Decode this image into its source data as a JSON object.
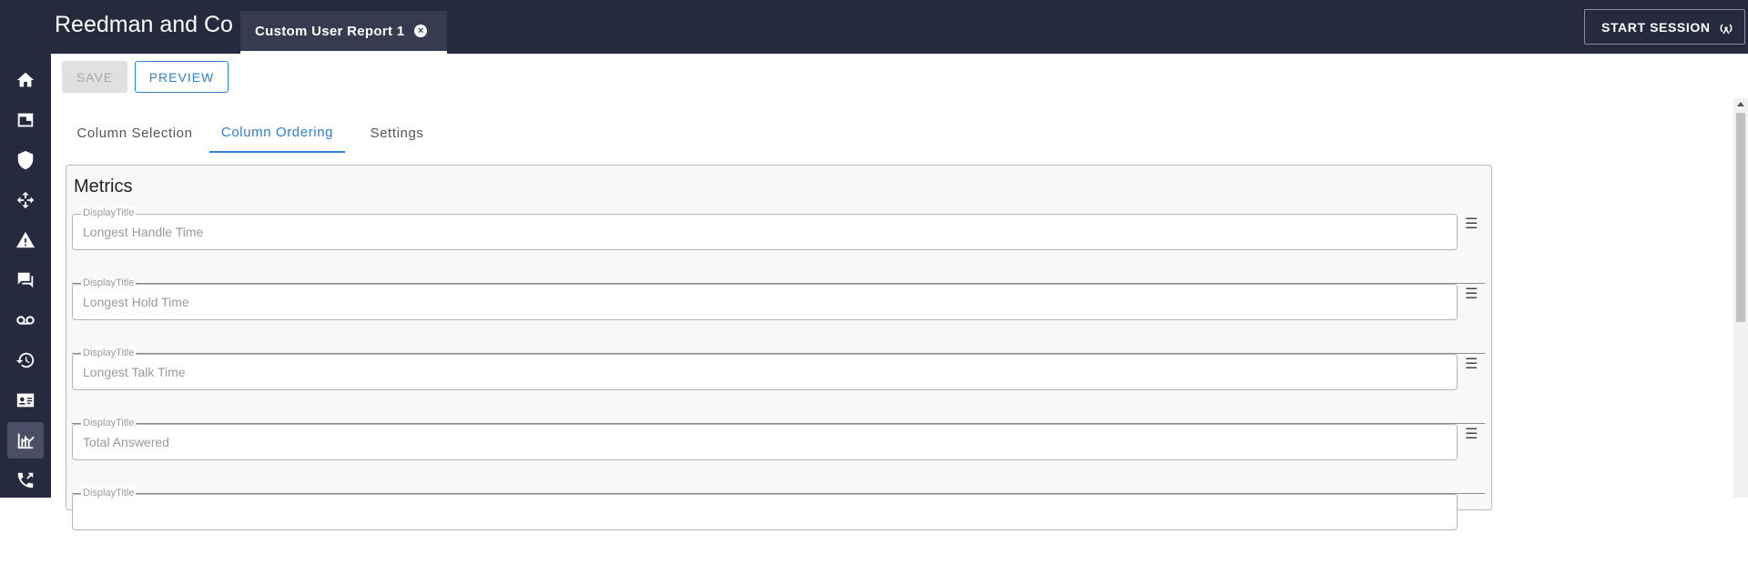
{
  "header": {
    "brand": "Reedman and Co",
    "open_tab": {
      "label": "Custom User Report 1",
      "close_icon": "close-circle-icon"
    },
    "start_session_label": "START SESSION",
    "start_session_icon": "antenna-icon"
  },
  "sidebar": {
    "items": [
      {
        "icon": "home-icon"
      },
      {
        "icon": "window-icon"
      },
      {
        "icon": "shield-icon"
      },
      {
        "icon": "move-arrows-icon"
      },
      {
        "icon": "warning-icon"
      },
      {
        "icon": "chat-icon"
      },
      {
        "icon": "voicemail-icon"
      },
      {
        "icon": "history-icon"
      },
      {
        "icon": "contact-card-icon"
      },
      {
        "icon": "reports-icon",
        "active": true
      },
      {
        "icon": "phone-transfer-icon"
      }
    ]
  },
  "toolbar": {
    "save_label": "SAVE",
    "preview_label": "PREVIEW"
  },
  "tabs": [
    {
      "label": "Column Selection",
      "active": false
    },
    {
      "label": "Column Ordering",
      "active": true
    },
    {
      "label": "Settings",
      "active": false
    }
  ],
  "panel": {
    "title": "Metrics",
    "rows": [
      {
        "label": "DisplayTitle",
        "value": "Longest Handle Time"
      },
      {
        "label": "DisplayTitle",
        "value": "Longest Hold Time"
      },
      {
        "label": "DisplayTitle",
        "value": "Longest Talk Time"
      },
      {
        "label": "DisplayTitle",
        "value": "Total Answered"
      },
      {
        "label": "DisplayTitle",
        "value": ""
      }
    ],
    "drag_icon": "drag-handle-icon"
  },
  "colors": {
    "topbar": "#262a3e",
    "accent": "#2f7fd6",
    "disabled": "#e0e0e0"
  }
}
